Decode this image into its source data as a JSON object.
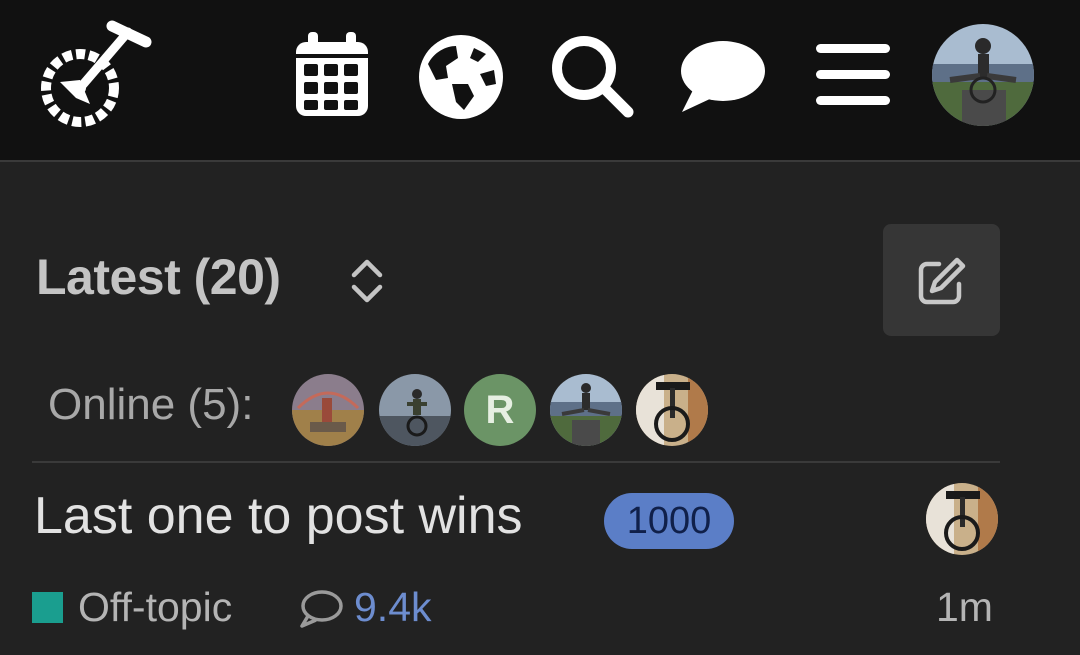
{
  "header": {
    "logo_icon": "unicycle-logo-icon",
    "icons": [
      "calendar-icon",
      "globe-icon",
      "search-icon",
      "chat-icon",
      "hamburger-menu-icon"
    ],
    "user_avatar": "user-avatar"
  },
  "main": {
    "title": "Latest (20)",
    "sort_icon": "chevron-up-down-icon",
    "new_topic_icon": "pencil-square-icon",
    "online": {
      "label": "Online (5):",
      "users": [
        {
          "type": "photo",
          "name": "online-user-1"
        },
        {
          "type": "photo",
          "name": "online-user-2"
        },
        {
          "type": "letter",
          "letter": "R",
          "color": "#6b9466"
        },
        {
          "type": "photo",
          "name": "online-user-4"
        },
        {
          "type": "photo",
          "name": "online-user-5"
        }
      ]
    }
  },
  "topics": [
    {
      "title": "Last one to post wins",
      "badge": "1000",
      "category": "Off-topic",
      "category_color": "#1a9e8f",
      "replies": "9.4k",
      "activity": "1m"
    }
  ],
  "colors": {
    "header_bg": "#111111",
    "page_bg": "#222222",
    "badge_bg": "#5b7ec7",
    "link": "#6d8dcf"
  }
}
